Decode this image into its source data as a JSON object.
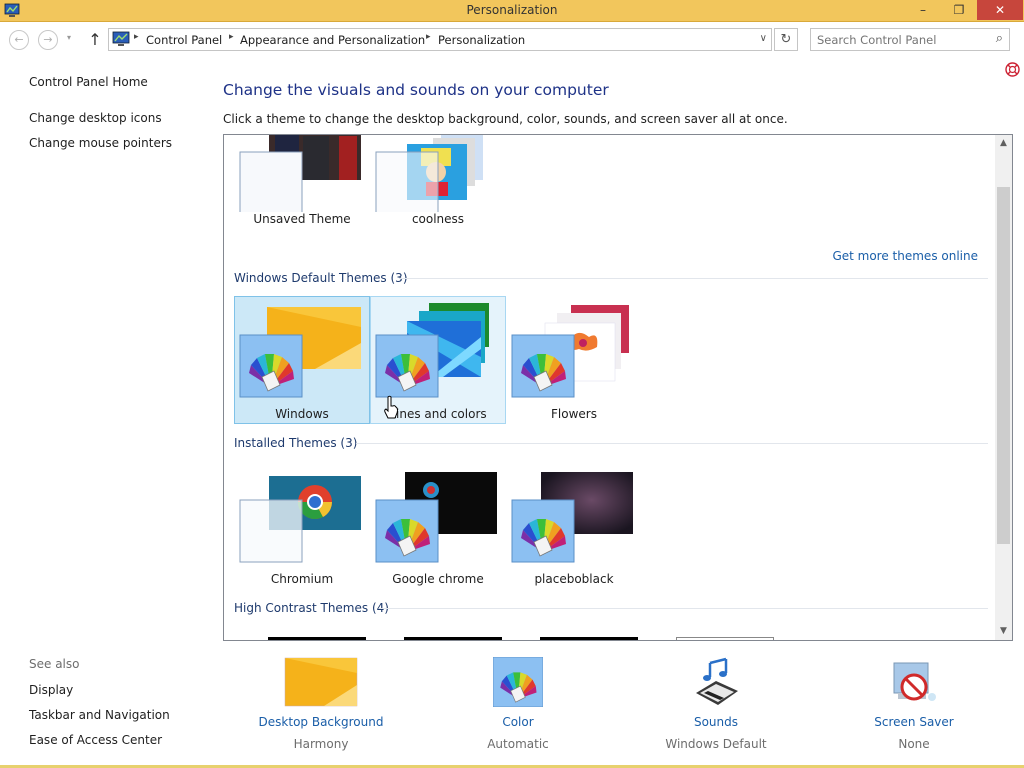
{
  "window": {
    "title": "Personalization",
    "min_glyph": "–",
    "restore_glyph": "❐",
    "close_glyph": "✕",
    "accent_color": "#f2c65c"
  },
  "nav": {
    "back_glyph": "←",
    "forward_glyph": "→",
    "dropdown_glyph": "▾",
    "up_glyph": "↑",
    "crumb_sep": "▸",
    "breadcrumbs": [
      "Control Panel",
      "Appearance and Personalization",
      "Personalization"
    ],
    "address_dropdown_glyph": "∨",
    "refresh_glyph": "↻",
    "search_placeholder": "Search Control Panel",
    "search_glyph": "⌕"
  },
  "sidebar": {
    "home": "Control Panel Home",
    "links": [
      "Change desktop icons",
      "Change mouse pointers"
    ],
    "see_also_title": "See also",
    "see_also": [
      "Display",
      "Taskbar and Navigation",
      "Ease of Access Center"
    ]
  },
  "main": {
    "heading": "Change the visuals and sounds on your computer",
    "subtext": "Click a theme to change the desktop background, color, sounds, and screen saver all at once.",
    "get_more": "Get more themes online",
    "my_themes": [
      {
        "label": "Unsaved Theme",
        "icon": "unsaved-theme-preview"
      },
      {
        "label": "coolness",
        "icon": "coolness-theme-preview"
      }
    ],
    "groups": [
      {
        "title": "Windows Default Themes (3)",
        "themes": [
          {
            "label": "Windows",
            "icon": "windows-theme-preview",
            "state": "selected"
          },
          {
            "label": "Lines and colors",
            "icon": "lines-colors-theme-preview",
            "state": "hover"
          },
          {
            "label": "Flowers",
            "icon": "flowers-theme-preview",
            "state": "normal"
          }
        ]
      },
      {
        "title": "Installed Themes (3)",
        "themes": [
          {
            "label": "Chromium",
            "icon": "chromium-theme-preview"
          },
          {
            "label": "Google chrome",
            "icon": "google-chrome-theme-preview"
          },
          {
            "label": "placeboblack",
            "icon": "placeboblack-theme-preview"
          }
        ]
      },
      {
        "title": "High Contrast Themes (4)",
        "themes": []
      }
    ],
    "scroll": {
      "up_glyph": "▲",
      "down_glyph": "▼"
    }
  },
  "bottom": [
    {
      "label": "Desktop Background",
      "value": "Harmony",
      "icon": "desktop-background-icon"
    },
    {
      "label": "Color",
      "value": "Automatic",
      "icon": "color-palette-icon"
    },
    {
      "label": "Sounds",
      "value": "Windows Default",
      "icon": "sounds-icon"
    },
    {
      "label": "Screen Saver",
      "value": "None",
      "icon": "screen-saver-icon"
    }
  ],
  "colors": {
    "heading": "#1e3287",
    "link": "#1a5ea8",
    "selected_tile": "#cce8f7"
  }
}
